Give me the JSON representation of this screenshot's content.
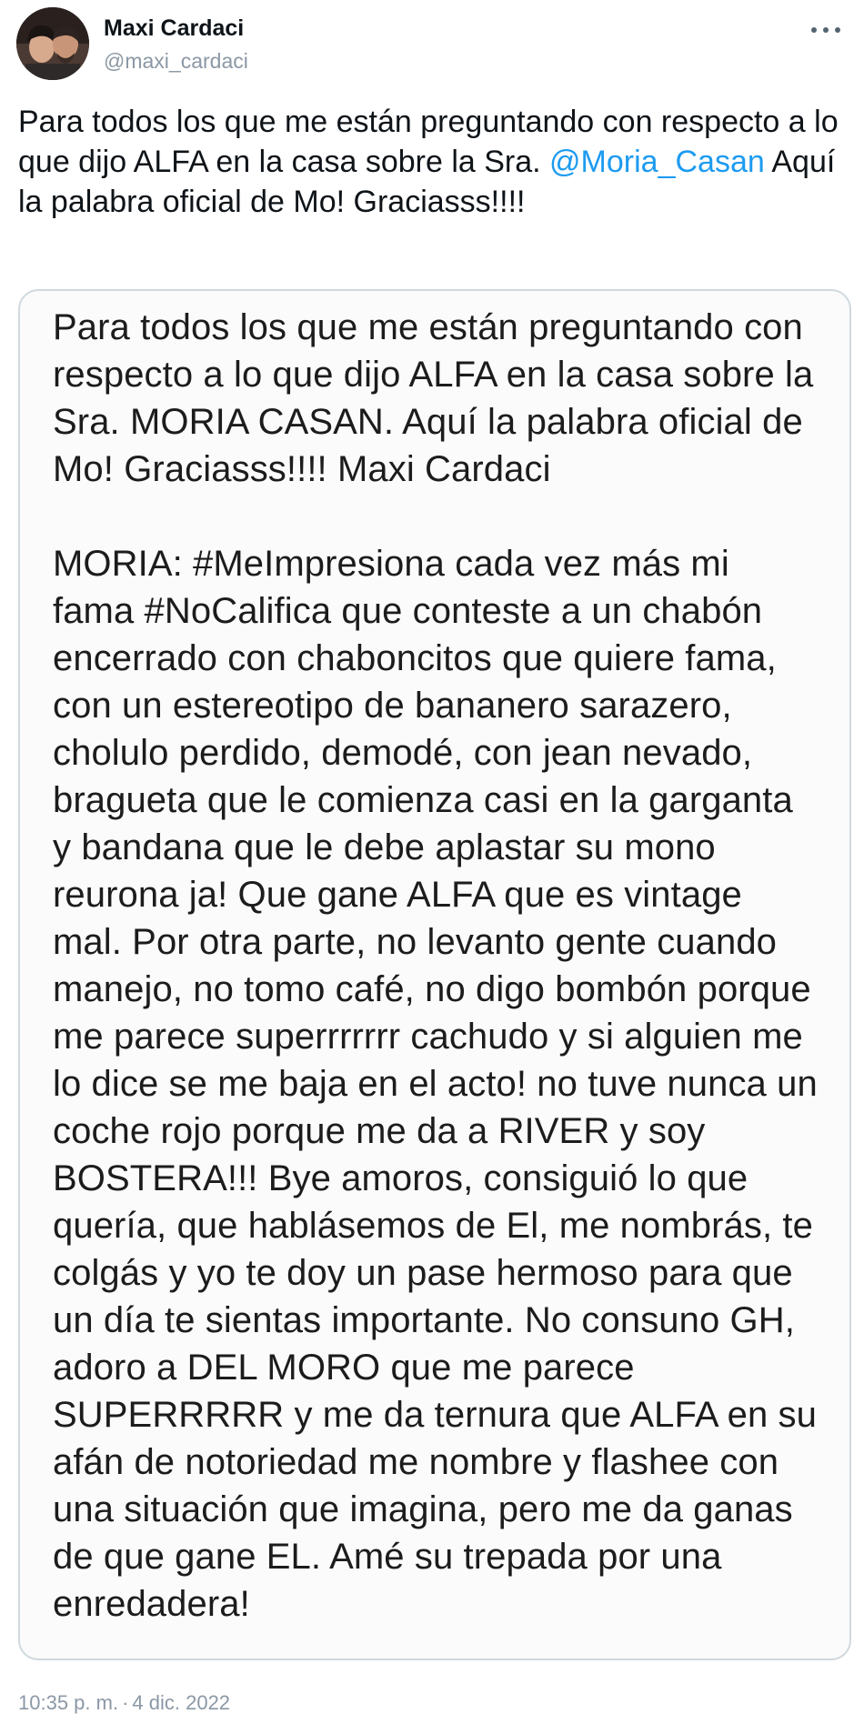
{
  "author": {
    "display_name": "Maxi Cardaci",
    "handle": "@maxi_cardaci"
  },
  "tweet": {
    "text_before_mention": "Para todos los que me están preguntando con respecto a lo que dijo ALFA en la casa sobre la Sra. ",
    "mention": "@Moria_Casan",
    "text_after_mention": " Aquí la palabra oficial de Mo! Graciasss!!!!"
  },
  "image_text": {
    "paragraph_1": "Para todos los que me están preguntando con respecto a lo que dijo ALFA en la casa sobre la Sra. MORIA CASAN. Aquí la palabra oficial de Mo! Graciasss!!!! Maxi Cardaci",
    "paragraph_2": "MORIA: #MeImpresiona cada vez más mi fama #NoCalifica que conteste a un chabón encerrado con chaboncitos que quiere fama, con un estereotipo de bananero sarazero, cholulo perdido, demodé, con jean nevado, bragueta que le comienza casi en la garganta y bandana que le debe aplastar su mono reurona ja! Que gane ALFA que es vintage mal. Por otra parte, no levanto gente cuando manejo, no tomo café, no digo bombón porque me parece superrrrrrr cachudo y si alguien me lo dice se me baja en el acto! no tuve nunca un coche rojo porque me da a RIVER y soy BOSTERA!!! Bye amoros, consiguió lo que quería, que hablásemos de El, me nombrás, te colgás y yo te doy un pase hermoso para que un día te sientas importante. No consuno GH, adoro a DEL MORO que me parece SUPERRRRR y me da ternura que ALFA en su afán de notoriedad me nombre y flashee con una situación que imagina, pero me da ganas de que gane EL. Amé su trepada por una enredadera!"
  },
  "meta": {
    "time": "10:35 p. m.",
    "separator": "·",
    "date": "4 dic. 2022"
  },
  "icons": {
    "more": "more-options-icon",
    "avatar": "profile-avatar"
  },
  "colors": {
    "link": "#1d9bf0",
    "secondary_text": "#8b98a5",
    "border": "#cfd9de"
  }
}
